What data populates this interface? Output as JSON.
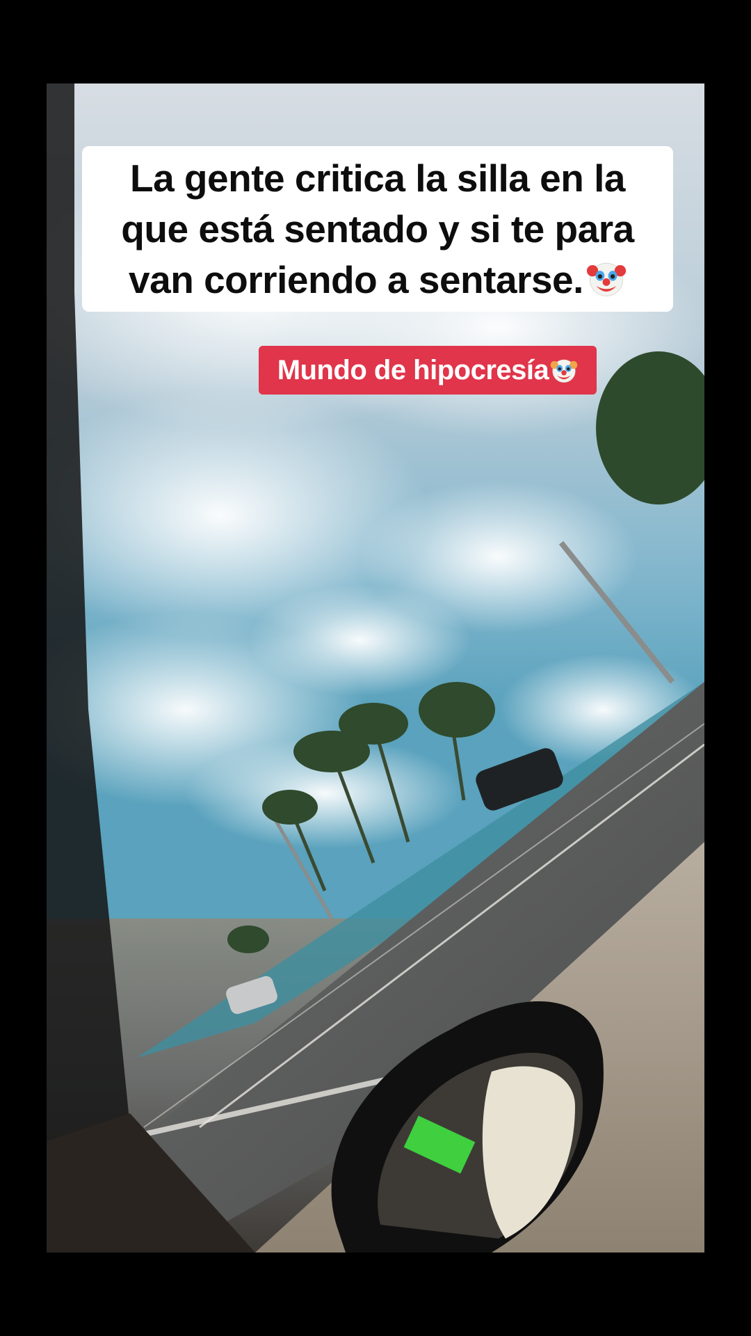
{
  "caption": {
    "line1": "La gente critica la silla en la",
    "line2": "que está sentado y si te para",
    "line3": "van corriendo a sentarse.",
    "emoji_icon": "clown-face-icon"
  },
  "tag": {
    "text": "Mundo de hipocresía",
    "emoji_icon": "clown-face-icon",
    "color": "#e0354a"
  },
  "scene": {
    "description_icon": "car-window-road-scene"
  }
}
